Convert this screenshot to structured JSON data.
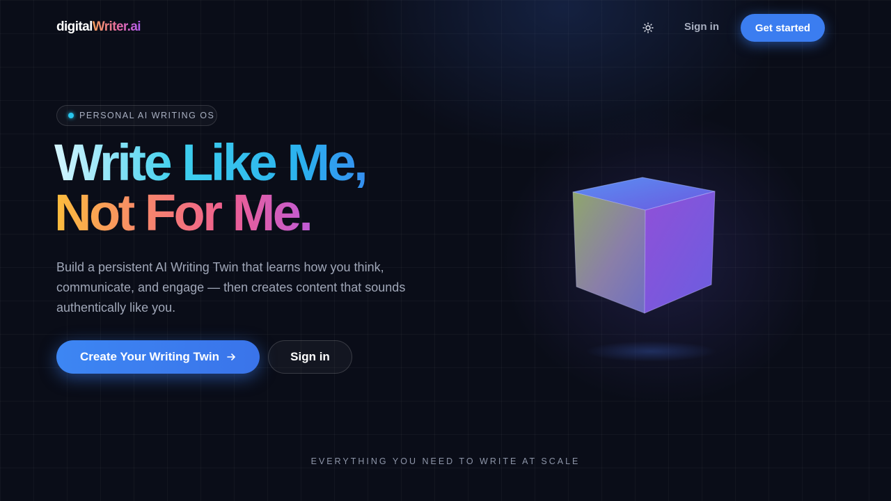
{
  "header": {
    "logo_part1": "digital",
    "logo_part2": "Writer.ai",
    "theme_icon": "sun-icon",
    "signin_label": "Sign in",
    "get_started_label": "Get started"
  },
  "hero": {
    "badge": "PERSONAL AI WRITING OS",
    "headline_line1": "Write Like Me,",
    "headline_line2": "Not For Me.",
    "description": "Build a persistent AI Writing Twin that learns how you think, communicate, and engage — then creates content that sounds authentically like you.",
    "cta_primary_label": "Create Your Writing Twin",
    "cta_primary_icon": "arrow-right-icon",
    "cta_secondary_label": "Sign in"
  },
  "footer_caption": "EVERYTHING YOU NEED TO WRITE AT SCALE",
  "colors": {
    "background": "#0a0d18",
    "accent_blue": "#3b7df0",
    "badge_dot": "#28c6ee"
  }
}
